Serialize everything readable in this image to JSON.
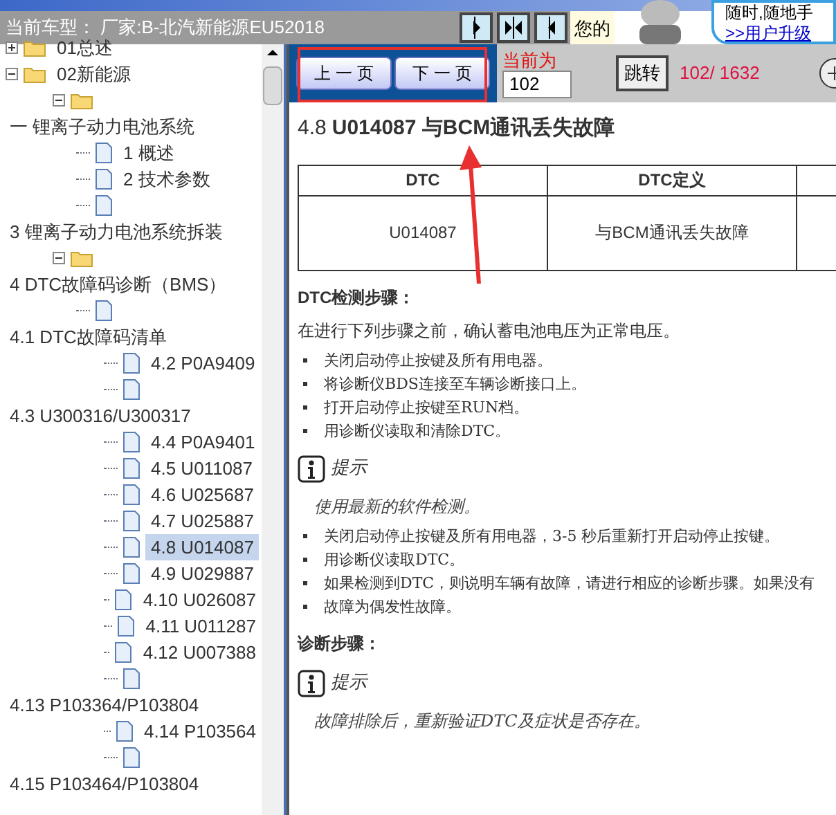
{
  "header": {
    "vehicle_label": "当前车型： 厂家:B-北汽新能源EU52018",
    "greeting": "您的",
    "banner_lines": [
      "随时,随地手",
      ">>用户升级"
    ]
  },
  "tree": [
    {
      "label": "01总述",
      "kind": "folder",
      "expanded": false,
      "selected": false
    },
    {
      "label": "02新能源",
      "kind": "folder",
      "expanded": true,
      "selected": false,
      "children": [
        {
          "kind": "folder",
          "expanded": true,
          "selected": false
        }
      ]
    },
    {
      "label": "一 锂离子动力电池系统",
      "kind": "heading",
      "selected": false,
      "children": [
        {
          "label": "1 概述",
          "kind": "page",
          "selected": false
        },
        {
          "label": "2 技术参数",
          "kind": "page",
          "selected": false
        },
        {
          "kind": "page",
          "selected": false
        }
      ]
    },
    {
      "label": "3 锂离子动力电池系统拆装",
      "kind": "heading",
      "selected": false,
      "children": [
        {
          "kind": "folder",
          "expanded": true,
          "selected": false
        }
      ]
    },
    {
      "label": "4 DTC故障码诊断（BMS）",
      "kind": "heading",
      "selected": false,
      "children": [
        {
          "kind": "page",
          "selected": false
        }
      ]
    },
    {
      "label": "4.1 DTC故障码清单",
      "kind": "heading",
      "selected": false,
      "children": [
        {
          "label": "4.2 P0A9409",
          "kind": "page",
          "selected": false
        },
        {
          "kind": "page",
          "selected": false
        }
      ]
    },
    {
      "label": "4.3 U300316/U300317",
      "kind": "heading",
      "selected": false,
      "children": [
        {
          "label": "4.4 P0A9401",
          "kind": "page",
          "selected": false
        },
        {
          "label": "4.5 U011087",
          "kind": "page",
          "selected": false
        },
        {
          "label": "4.6 U025687",
          "kind": "page",
          "selected": false
        },
        {
          "label": "4.7 U025887",
          "kind": "page",
          "selected": false
        },
        {
          "label": "4.8 U014087",
          "kind": "page",
          "selected": true
        },
        {
          "label": "4.9 U029887",
          "kind": "page",
          "selected": false
        },
        {
          "label": "4.10 U026087",
          "kind": "page",
          "selected": false
        },
        {
          "label": "4.11 U011287",
          "kind": "page",
          "selected": false
        },
        {
          "label": "4.12 U007388",
          "kind": "page",
          "selected": false
        },
        {
          "kind": "page",
          "selected": false
        }
      ]
    },
    {
      "label": "4.13 P103364/P103804",
      "kind": "heading",
      "selected": false,
      "children": [
        {
          "label": "4.14 P103564",
          "kind": "page",
          "selected": false
        },
        {
          "kind": "page",
          "selected": false
        }
      ]
    },
    {
      "label": "4.15 P103464/P103804",
      "kind": "heading",
      "selected": false
    }
  ],
  "toolbar": {
    "prev": "上 一 页",
    "next": "下 一 页",
    "current_label": "当前为",
    "page_value": "102",
    "jump": "跳转",
    "page_count": "102/ 1632"
  },
  "document": {
    "title_prefix": "4.8",
    "title": "U014087 与BCM通讯丢失故障",
    "table": {
      "columns": [
        "DTC",
        "DTC定义"
      ],
      "rows": [
        [
          "U014087",
          "与BCM通讯丢失故障"
        ]
      ]
    },
    "sections": [
      {
        "kind": "heading",
        "text": "DTC检测步骤："
      },
      {
        "kind": "para",
        "text": "在进行下列步骤之前，确认蓄电池电压为正常电压。"
      },
      {
        "kind": "bullets",
        "items": [
          "关闭启动停止按键及所有用电器。",
          "将诊断仪BDS连接至车辆诊断接口上。",
          "打开启动停止按键至RUN档。",
          "用诊断仪读取和清除DTC。"
        ]
      },
      {
        "kind": "note",
        "label": "提示",
        "text": "使用最新的软件检测。"
      },
      {
        "kind": "bullets",
        "items": [
          "关闭启动停止按键及所有用电器，3-5 秒后重新打开启动停止按键。",
          "用诊断仪读取DTC。",
          "如果检测到DTC，则说明车辆有故障，请进行相应的诊断步骤。如果没有",
          "故障为偶发性故障。"
        ]
      },
      {
        "kind": "heading",
        "text": "诊断步骤："
      },
      {
        "kind": "note",
        "label": "提示",
        "text": "故障排除后，重新验证DTC及症状是否存在。"
      }
    ]
  }
}
